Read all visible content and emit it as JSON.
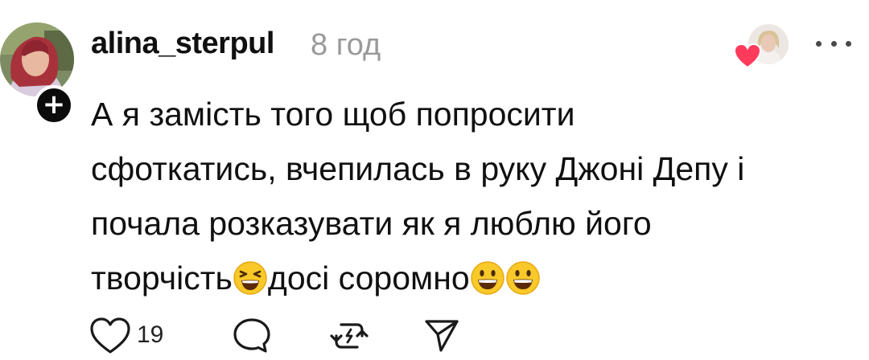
{
  "post": {
    "author": {
      "username": "alina_sterpul",
      "time": "8 год"
    },
    "body_lines": [
      "А я замість того щоб попросити",
      "сфоткатись, вчепилась в руку Джоні Депу і",
      "почала розказувати як я люблю його",
      "творчість",
      "досі соромно"
    ],
    "emojis": [
      "squinting-laughing-emoji",
      "grinning-face-emoji",
      "grinning-face-emoji"
    ],
    "actions": {
      "like_count": "19"
    },
    "colors": {
      "heart": "#ff3b5c",
      "muted_text": "#9a9a9a",
      "text": "#101010"
    }
  }
}
